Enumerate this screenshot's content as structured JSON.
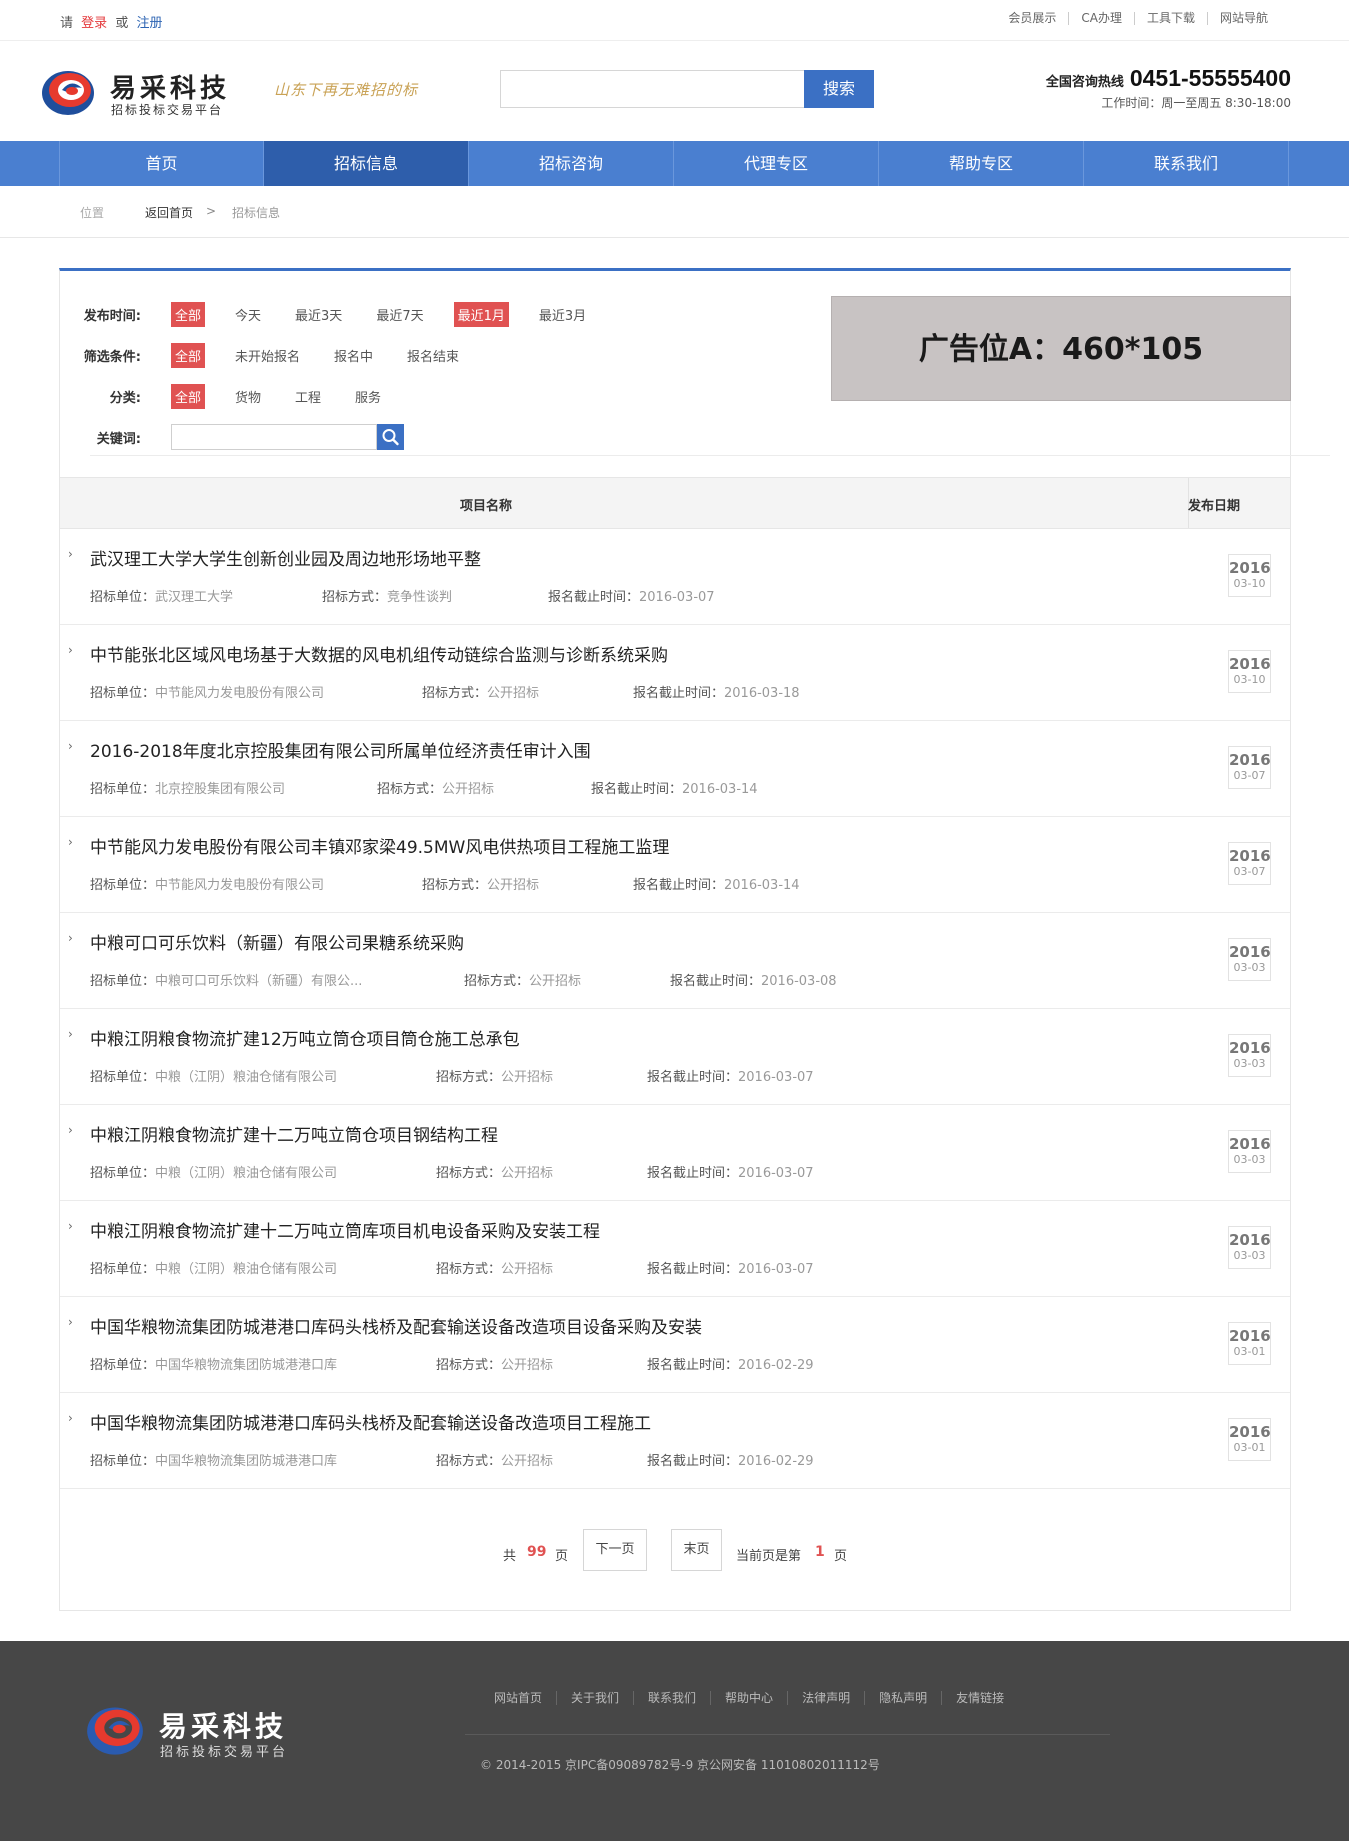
{
  "topbar": {
    "please": "请",
    "login": "登录",
    "or": "或",
    "register": "注册",
    "links": [
      "会员展示",
      "CA办理",
      "工具下载",
      "网站导航"
    ]
  },
  "header": {
    "brand": "易采科技",
    "brand_sub": "招标投标交易平台",
    "slogan": "山东下再无难招的标",
    "search_placeholder": "",
    "search_button": "搜索",
    "hotline_label": "全国咨询热线",
    "hotline_number": "0451-55555400",
    "work_hours": "工作时间：周一至周五 8:30-18:00"
  },
  "nav": {
    "items": [
      "首页",
      "招标信息",
      "招标咨询",
      "代理专区",
      "帮助专区",
      "联系我们"
    ],
    "active": "招标信息"
  },
  "breadcrumb": {
    "position": "位置",
    "home": "返回首页",
    "sep": ">",
    "current": "招标信息"
  },
  "filters": {
    "publish_time": {
      "label": "发布时间:",
      "options": [
        "全部",
        "今天",
        "最近3天",
        "最近7天",
        "最近1月",
        "最近3月"
      ],
      "selected": [
        "全部",
        "最近1月"
      ]
    },
    "condition": {
      "label": "筛选条件:",
      "options": [
        "全部",
        "未开始报名",
        "报名中",
        "报名结束"
      ],
      "selected": [
        "全部"
      ]
    },
    "category": {
      "label": "分类:",
      "options": [
        "全部",
        "货物",
        "工程",
        "服务"
      ],
      "selected": [
        "全部"
      ]
    },
    "keyword": {
      "label": "关键词:",
      "value": ""
    }
  },
  "ad": {
    "text": "广告位A：460*105"
  },
  "table": {
    "col_name": "项目名称",
    "col_date": "发布日期",
    "unit_label": "招标单位：",
    "method_label": "招标方式：",
    "deadline_label": "报名截止时间：",
    "rows": [
      {
        "title": "武汉理工大学大学生创新创业园及周边地形场地平整",
        "unit": "武汉理工大学",
        "method": "竞争性谈判",
        "deadline": "2016-03-07",
        "year": "2016",
        "md": "03-10"
      },
      {
        "title": "中节能张北区域风电场基于大数据的风电机组传动链综合监测与诊断系统采购",
        "unit": "中节能风力发电股份有限公司",
        "method": "公开招标",
        "deadline": "2016-03-18",
        "year": "2016",
        "md": "03-10"
      },
      {
        "title": "2016-2018年度北京控股集团有限公司所属单位经济责任审计入围",
        "unit": "北京控股集团有限公司",
        "method": "公开招标",
        "deadline": "2016-03-14",
        "year": "2016",
        "md": "03-07"
      },
      {
        "title": "中节能风力发电股份有限公司丰镇邓家梁49.5MW风电供热项目工程施工监理",
        "unit": "中节能风力发电股份有限公司",
        "method": "公开招标",
        "deadline": "2016-03-14",
        "year": "2016",
        "md": "03-07"
      },
      {
        "title": "中粮可口可乐饮料（新疆）有限公司果糖系统采购",
        "unit": "中粮可口可乐饮料（新疆）有限公...",
        "method": "公开招标",
        "deadline": "2016-03-08",
        "year": "2016",
        "md": "03-03"
      },
      {
        "title": "中粮江阴粮食物流扩建12万吨立筒仓项目筒仓施工总承包",
        "unit": "中粮（江阴）粮油仓储有限公司",
        "method": "公开招标",
        "deadline": "2016-03-07",
        "year": "2016",
        "md": "03-03"
      },
      {
        "title": "中粮江阴粮食物流扩建十二万吨立筒仓项目钢结构工程",
        "unit": "中粮（江阴）粮油仓储有限公司",
        "method": "公开招标",
        "deadline": "2016-03-07",
        "year": "2016",
        "md": "03-03"
      },
      {
        "title": "中粮江阴粮食物流扩建十二万吨立筒库项目机电设备采购及安装工程",
        "unit": "中粮（江阴）粮油仓储有限公司",
        "method": "公开招标",
        "deadline": "2016-03-07",
        "year": "2016",
        "md": "03-03"
      },
      {
        "title": "中国华粮物流集团防城港港口库码头栈桥及配套输送设备改造项目设备采购及安装",
        "unit": "中国华粮物流集团防城港港口库",
        "method": "公开招标",
        "deadline": "2016-02-29",
        "year": "2016",
        "md": "03-01"
      },
      {
        "title": "中国华粮物流集团防城港港口库码头栈桥及配套输送设备改造项目工程施工",
        "unit": "中国华粮物流集团防城港港口库",
        "method": "公开招标",
        "deadline": "2016-02-29",
        "year": "2016",
        "md": "03-01"
      }
    ]
  },
  "pager": {
    "total_prefix": "共",
    "total_pages": "99",
    "total_suffix": "页",
    "next": "下一页",
    "last": "末页",
    "current_prefix": "当前页是第",
    "current_page": "1",
    "current_suffix": "页"
  },
  "footer": {
    "brand": "易采科技",
    "brand_sub": "招标投标交易平台",
    "links": [
      "网站首页",
      "关于我们",
      "联系我们",
      "帮助中心",
      "法律声明",
      "隐私声明",
      "友情链接"
    ],
    "copyright": "© 2014-2015 京IPC备09089782号-9 京公网安备 11010802011112号"
  },
  "colors": {
    "primary": "#3b70c4",
    "nav": "#4a7fd0",
    "nav_active": "#2e5eab",
    "selected_tag": "#e05252",
    "footer": "#474747"
  }
}
